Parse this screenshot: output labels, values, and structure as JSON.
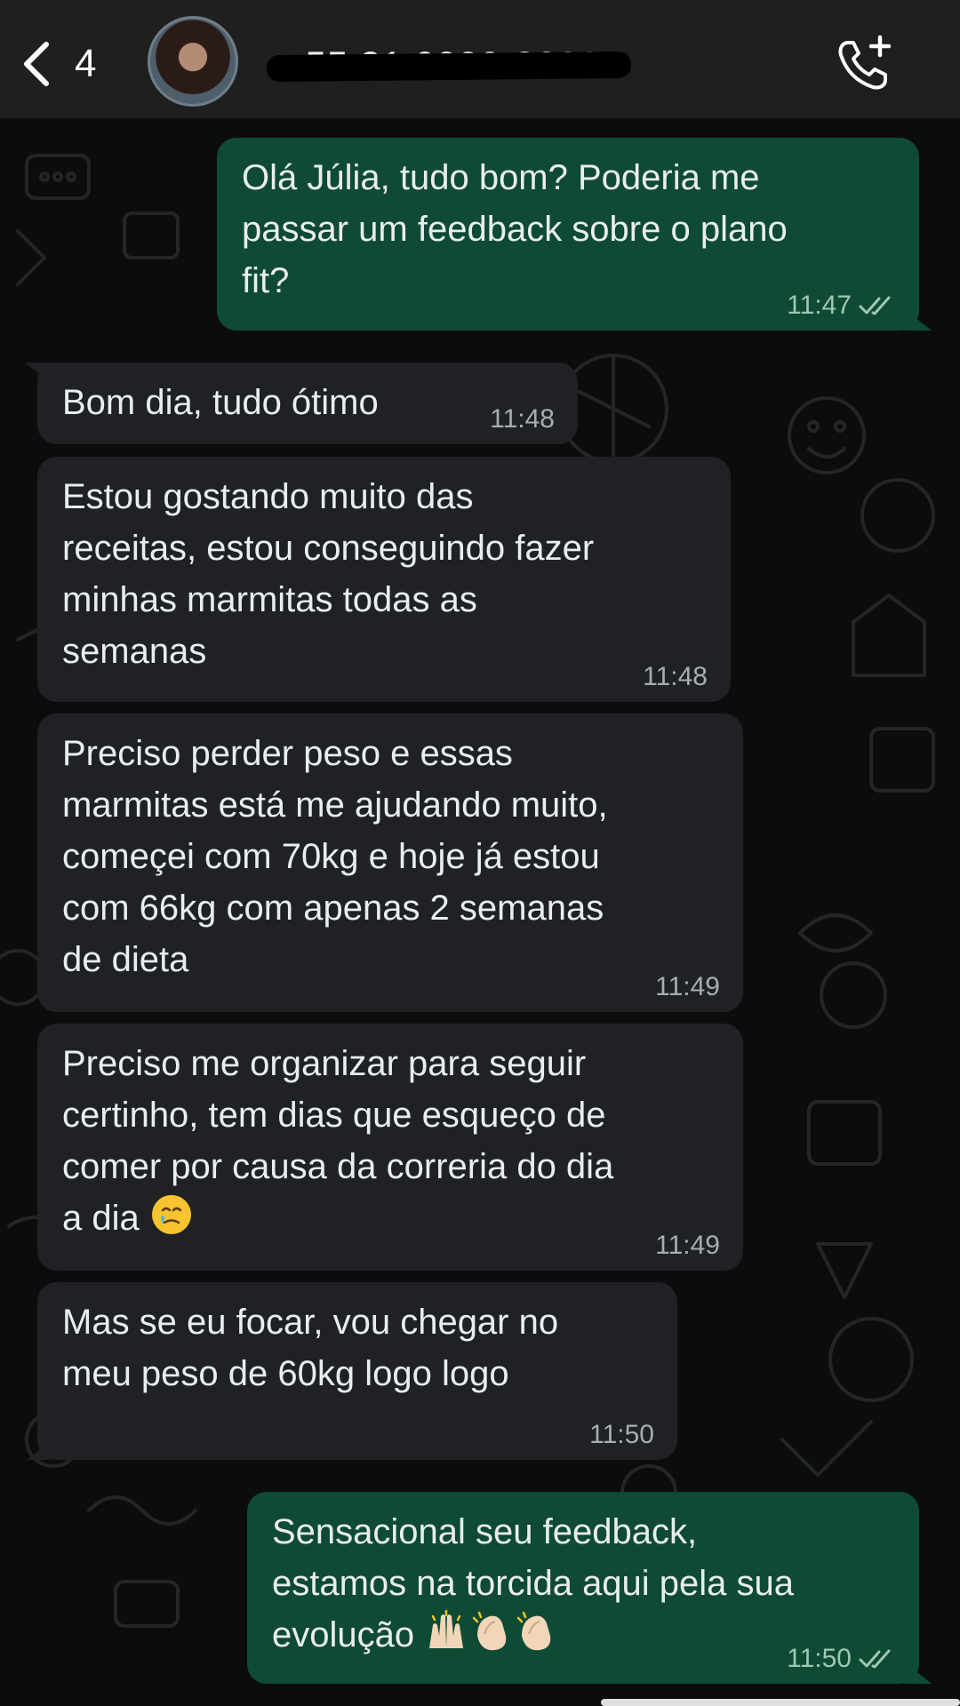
{
  "header": {
    "back_count": "4",
    "contact_name": "+55 21 0000-8000",
    "call_icon": "phone-add-icon"
  },
  "messages": [
    {
      "dir": "out",
      "text": "Olá Júlia, tudo bom? Poderia me\npassar um feedback sobre o plano\nfit?",
      "time": "11:47",
      "status": "read"
    },
    {
      "dir": "in",
      "text": "Bom dia, tudo ótimo",
      "time": "11:48"
    },
    {
      "dir": "in",
      "text": "Estou gostando muito das\nreceitas, estou conseguindo fazer\nminhas marmitas todas as\nsemanas",
      "time": "11:48"
    },
    {
      "dir": "in",
      "text": "Preciso perder peso e essas\nmarmitas está me ajudando muito,\ncomeçei com 70kg e hoje já estou\ncom 66kg com apenas 2 semanas\nde dieta",
      "time": "11:49"
    },
    {
      "dir": "in",
      "text": "Preciso me organizar para seguir\ncertinho, tem dias que esqueço de\ncomer por causa da correria do dia\na dia",
      "emoji": "face-holding-back-tears",
      "time": "11:49"
    },
    {
      "dir": "in",
      "text": "Mas se eu focar, vou chegar no\nmeu peso de 60kg logo logo",
      "time": "11:50"
    },
    {
      "dir": "out",
      "text": "Sensacional seu feedback,\nestamos na torcida aqui pela sua\nevolução",
      "emoji": "raising-hands clapping-hands clapping-hands",
      "time": "11:50",
      "status": "read"
    }
  ],
  "colors": {
    "incoming_bubble": "#1f2124",
    "outgoing_bubble": "#0e4a34",
    "header": "#1f1f1f",
    "background": "#0b0d0c"
  }
}
